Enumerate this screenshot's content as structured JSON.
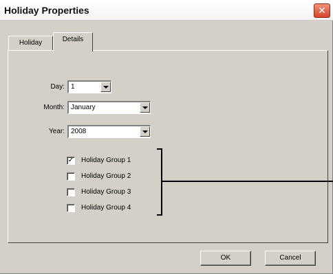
{
  "window": {
    "title": "Holiday Properties",
    "close_symbol": "✕"
  },
  "tabs": [
    {
      "label": "Holiday",
      "active": false
    },
    {
      "label": "Details",
      "active": true
    }
  ],
  "fields": {
    "day": {
      "label": "Day:",
      "value": "1"
    },
    "month": {
      "label": "Month:",
      "value": "January"
    },
    "year": {
      "label": "Year:",
      "value": "2008"
    }
  },
  "groups": [
    {
      "label": "Holiday Group 1",
      "checked": true
    },
    {
      "label": "Holiday Group 2",
      "checked": false
    },
    {
      "label": "Holiday Group 3",
      "checked": false
    },
    {
      "label": "Holiday Group 4",
      "checked": false
    }
  ],
  "buttons": {
    "ok": "OK",
    "cancel": "Cancel"
  },
  "colors": {
    "dialog_bg": "#d4d0c8",
    "close_red": "#d6452b"
  }
}
